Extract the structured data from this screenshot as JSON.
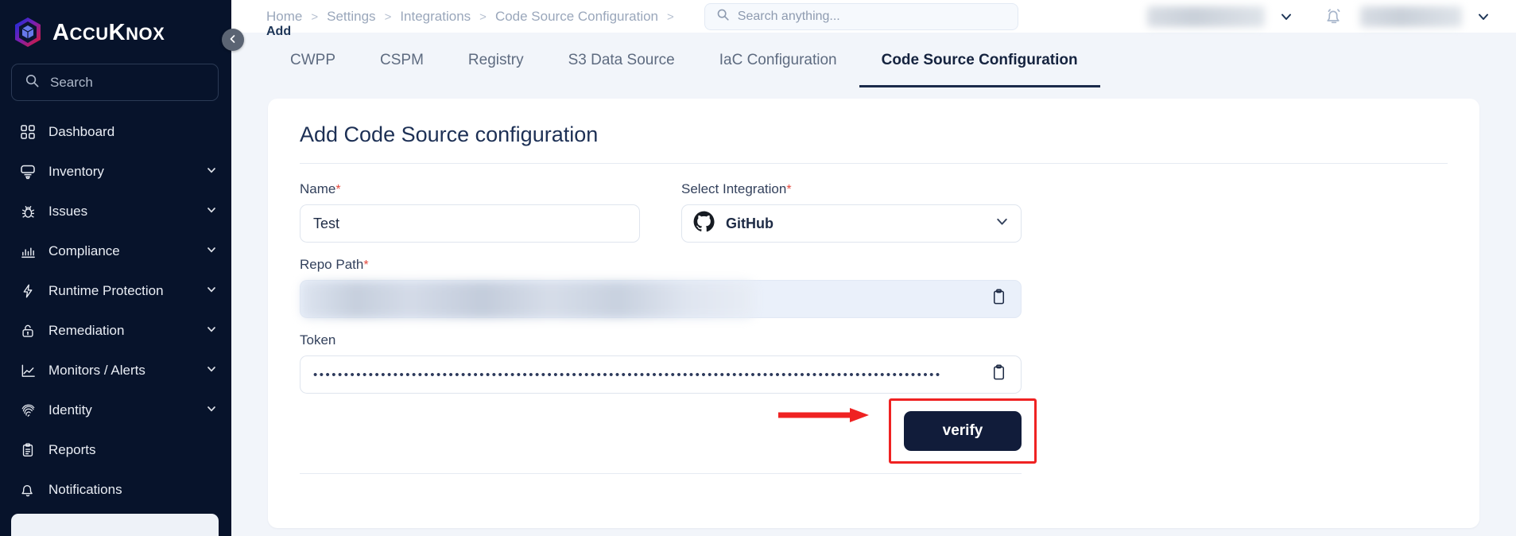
{
  "brand": {
    "name_part1": "A",
    "name_part2": "CCU",
    "name_part3": "K",
    "name_part4": "NOX",
    "full": "AccuKnox"
  },
  "sidebar": {
    "search_placeholder": "Search",
    "items": [
      {
        "label": "Dashboard",
        "icon": "grid-icon",
        "chevron": false
      },
      {
        "label": "Inventory",
        "icon": "inventory-icon",
        "chevron": true
      },
      {
        "label": "Issues",
        "icon": "bug-icon",
        "chevron": true
      },
      {
        "label": "Compliance",
        "icon": "bar-chart-icon",
        "chevron": true
      },
      {
        "label": "Runtime Protection",
        "icon": "bolt-icon",
        "chevron": true
      },
      {
        "label": "Remediation",
        "icon": "unlock-icon",
        "chevron": true
      },
      {
        "label": "Monitors / Alerts",
        "icon": "line-chart-icon",
        "chevron": true
      },
      {
        "label": "Identity",
        "icon": "fingerprint-icon",
        "chevron": true
      },
      {
        "label": "Reports",
        "icon": "clipboard-icon",
        "chevron": false
      },
      {
        "label": "Notifications",
        "icon": "bell-icon",
        "chevron": false
      }
    ]
  },
  "topbar": {
    "breadcrumbs": [
      "Home",
      "Settings",
      "Integrations",
      "Code Source Configuration"
    ],
    "separator": ">",
    "current": "Add",
    "search_placeholder": "Search anything...",
    "notification_icon": "bell-icon"
  },
  "tabs": [
    {
      "label": "CWPP",
      "active": false
    },
    {
      "label": "CSPM",
      "active": false
    },
    {
      "label": "Registry",
      "active": false
    },
    {
      "label": "S3 Data Source",
      "active": false
    },
    {
      "label": "IaC Configuration",
      "active": false
    },
    {
      "label": "Code Source Configuration",
      "active": true
    }
  ],
  "form": {
    "title": "Add Code Source configuration",
    "required_marker": "*",
    "name": {
      "label": "Name",
      "value": "Test",
      "required": true
    },
    "integration": {
      "label": "Select Integration",
      "value": "GitHub",
      "required": true,
      "icon": "github-icon"
    },
    "repo_path": {
      "label": "Repo Path",
      "value": "",
      "required": true,
      "redacted": true,
      "copy_icon": "clipboard-copy-icon"
    },
    "token": {
      "label": "Token",
      "value": "••••••••••••••••••••••••••••••••••••••••••••••••••••••••••••••••••••••••••••••••••••••••••••••••••••••",
      "required": false,
      "copy_icon": "clipboard-copy-icon"
    },
    "verify_button": "verify"
  },
  "annotation": {
    "highlight_color": "#ef2222",
    "arrow_icon": "right-arrow-annotation",
    "target": "verify"
  },
  "colors": {
    "sidebar_bg": "#07132b",
    "page_bg": "#f2f5fa",
    "card_bg": "#ffffff",
    "accent_dark": "#111c3a",
    "required_red": "#e4493e",
    "annotation_red": "#ef2222"
  }
}
